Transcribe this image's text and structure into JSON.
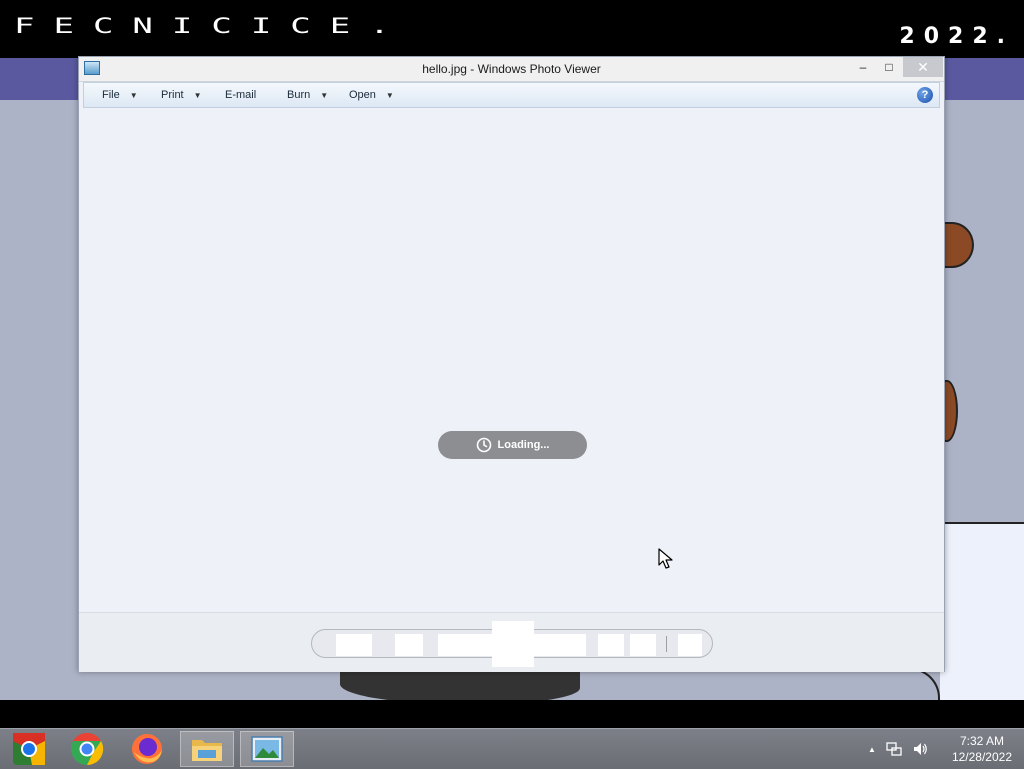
{
  "wallpaper": {
    "logo_text": "FECNICICE.",
    "year_text": "2022."
  },
  "window": {
    "title": "hello.jpg - Windows Photo Viewer",
    "minimize": "‒",
    "maximize": "□",
    "close": "✕"
  },
  "menu": {
    "file": "File",
    "print": "Print",
    "email": "E-mail",
    "burn": "Burn",
    "open": "Open",
    "help": "?"
  },
  "status": {
    "loading": "Loading..."
  },
  "taskbar": {
    "apps": [
      "Chromium",
      "Google Chrome",
      "Firefox",
      "File Explorer",
      "Windows Photo Viewer"
    ],
    "active_app": "Windows Photo Viewer",
    "time": "7:32 AM",
    "date": "12/28/2022",
    "tray_up": "▲"
  },
  "colors": {
    "wallpaper": "#adb3c6",
    "purple_band": "#5a59a0",
    "viewer_bg": "#eef1f8",
    "loading_pill": "#8c8e92",
    "taskbar": "#747780"
  }
}
